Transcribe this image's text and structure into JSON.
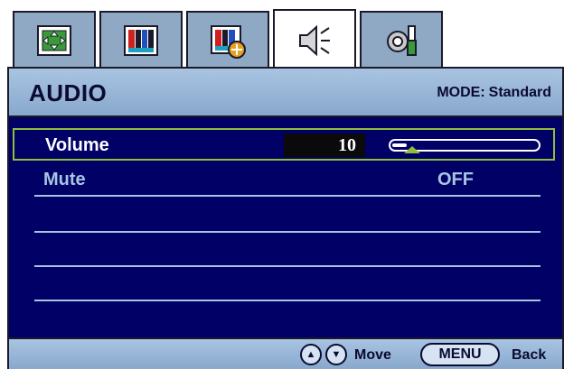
{
  "tabs": [
    {
      "icon": "display-position-icon",
      "active": false
    },
    {
      "icon": "picture-icon",
      "active": false
    },
    {
      "icon": "picture-advanced-icon",
      "active": false
    },
    {
      "icon": "speaker-icon",
      "active": true
    },
    {
      "icon": "system-settings-icon",
      "active": false
    }
  ],
  "header": {
    "title": "AUDIO",
    "mode_label": "MODE:",
    "mode_value": "Standard"
  },
  "menu": {
    "volume": {
      "label": "Volume",
      "value": "10",
      "level_fraction": 0.1
    },
    "mute": {
      "label": "Mute",
      "value": "OFF"
    }
  },
  "footer": {
    "move_label": "Move",
    "menu_label": "MENU",
    "back_label": "Back"
  },
  "colors": {
    "panel_bg": "#000066",
    "bar_bg": "#a9c4e2",
    "highlight": "#8fbf3a",
    "tab_bg": "#8fa8c4"
  }
}
